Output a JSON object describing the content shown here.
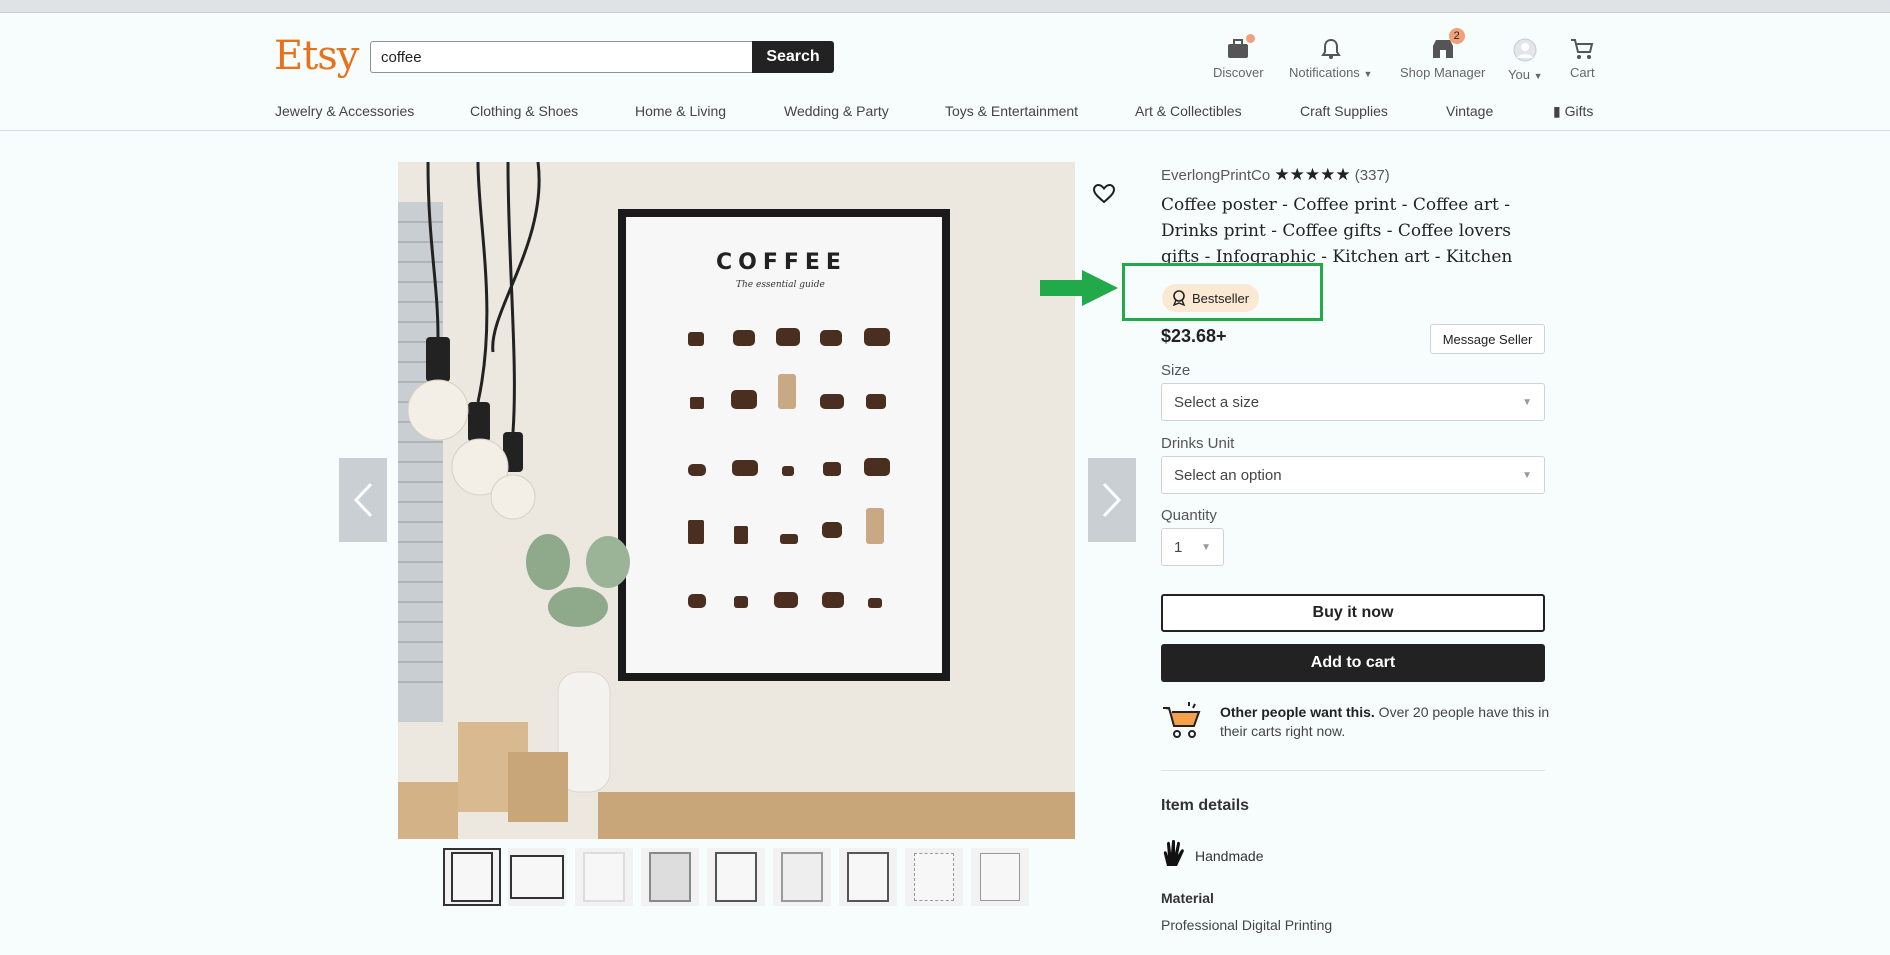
{
  "header": {
    "logo": "Etsy",
    "search": {
      "value": "coffee",
      "placeholder": "",
      "button_label": "Search"
    },
    "nav": [
      {
        "label": "Discover",
        "icon": "discover-icon"
      },
      {
        "label": "Notifications",
        "icon": "bell-icon"
      },
      {
        "label": "Shop Manager",
        "icon": "shop-icon",
        "badge": "2"
      },
      {
        "label": "You",
        "icon": "avatar-icon"
      },
      {
        "label": "Cart",
        "icon": "cart-icon"
      }
    ],
    "categories": [
      "Jewelry & Accessories",
      "Clothing & Shoes",
      "Home & Living",
      "Wedding & Party",
      "Toys & Entertainment",
      "Art & Collectibles",
      "Craft Supplies",
      "Vintage",
      "Gifts"
    ]
  },
  "gallery": {
    "poster_title": "COFFEE",
    "poster_subtitle": "The essential guide",
    "thumbnail_count": 9,
    "selected_thumbnail": 1
  },
  "product": {
    "shop_name": "EverlongPrintCo",
    "rating_stars": "★★★★★",
    "review_count": "(337)",
    "title": "Coffee poster - Coffee print - Coffee art - Drinks print - Coffee gifts - Coffee lovers gifts - Infographic - Kitchen art - Kitchen poster",
    "badge": "Bestseller",
    "price": "$23.68+",
    "message_seller": "Message Seller",
    "size_label": "Size",
    "size_value": "Select a size",
    "drinks_label": "Drinks Unit",
    "drinks_value": "Select an option",
    "quantity_label": "Quantity",
    "quantity_value": "1",
    "buy_now": "Buy it now",
    "add_to_cart": "Add to cart",
    "demand_bold": "Other people want this.",
    "demand_text": " Over 20 people have this in their carts right now.",
    "item_details": "Item details",
    "handmade": "Handmade",
    "material_label": "Material",
    "material_value": "Professional Digital Printing"
  },
  "colors": {
    "brand": "#e8721c",
    "annotation": "#22a94a"
  }
}
